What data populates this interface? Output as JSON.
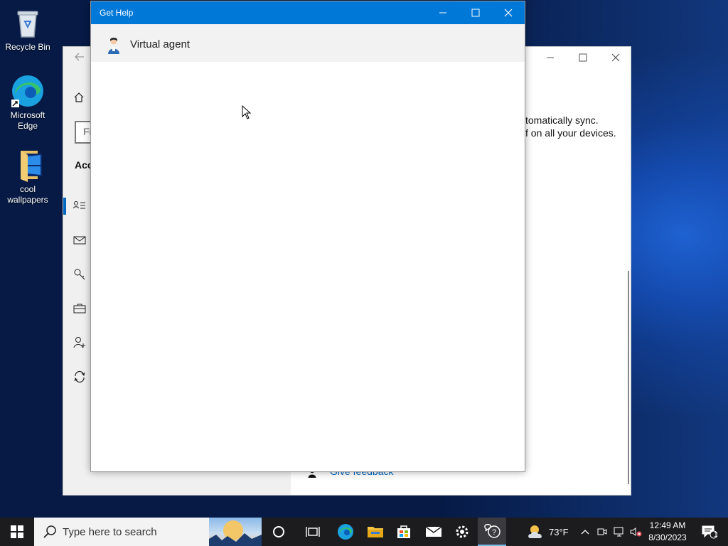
{
  "desktop": {
    "icons": [
      {
        "label": "Recycle Bin"
      },
      {
        "label": "Microsoft Edge"
      },
      {
        "label": "cool wallpapers"
      }
    ]
  },
  "settings_window": {
    "search_placeholder": "Fi",
    "section_heading": "Acc",
    "sync_text_line1": "tomatically sync.",
    "sync_text_line2": "f on all your devices.",
    "feedback_link": "Give feedback"
  },
  "get_help": {
    "title": "Get Help",
    "agent_name": "Virtual agent"
  },
  "taskbar": {
    "search_placeholder": "Type here to search",
    "weather_temp": "73°F",
    "time": "12:49 AM",
    "date": "8/30/2023",
    "notification_count": "1"
  },
  "colors": {
    "titlebar": "#0078d7",
    "accent": "#0067c0",
    "taskbar": "#1c1c1f"
  }
}
